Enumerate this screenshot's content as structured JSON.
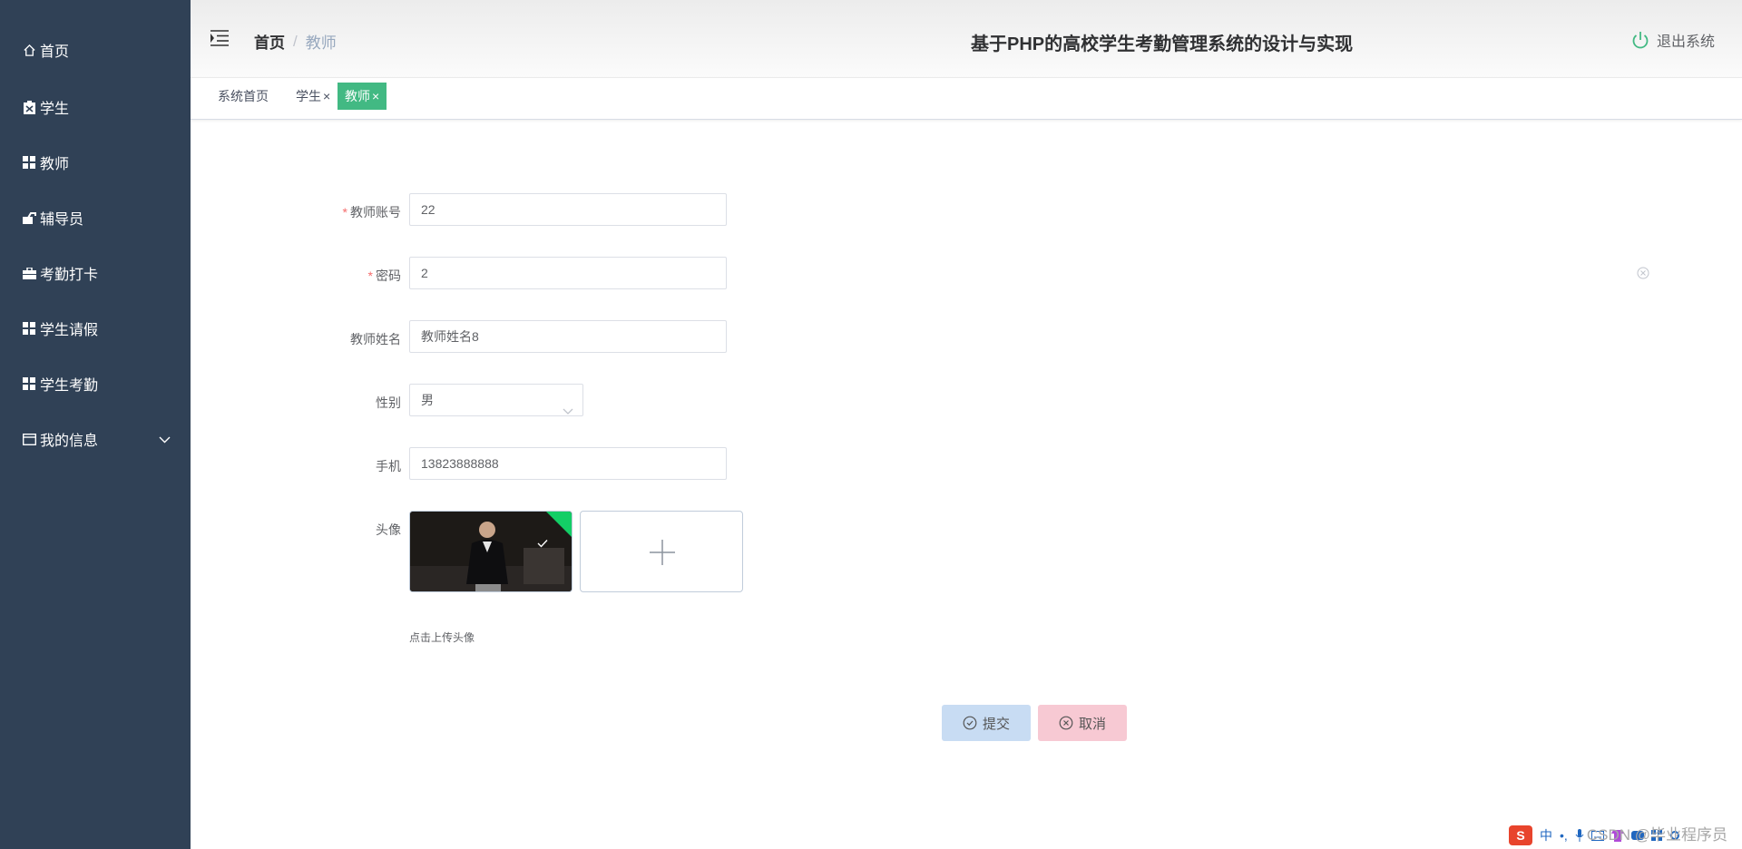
{
  "sidebar": {
    "items": [
      {
        "label": "首页",
        "icon": "home-icon"
      },
      {
        "label": "学生",
        "icon": "clipboard-icon"
      },
      {
        "label": "教师",
        "icon": "grid-icon"
      },
      {
        "label": "辅导员",
        "icon": "share-icon"
      },
      {
        "label": "考勤打卡",
        "icon": "briefcase-icon"
      },
      {
        "label": "学生请假",
        "icon": "grid-icon"
      },
      {
        "label": "学生考勤",
        "icon": "grid-icon"
      },
      {
        "label": "我的信息",
        "icon": "card-icon"
      }
    ]
  },
  "header": {
    "breadcrumb": [
      "首页",
      "教师"
    ],
    "breadcrumb_sep": "/",
    "title": "基于PHP的高校学生考勤管理系统的设计与实现",
    "logout": "退出系统"
  },
  "tags": [
    {
      "label": "系统首页",
      "closable": false,
      "active": false
    },
    {
      "label": "学生",
      "closable": true,
      "active": false
    },
    {
      "label": "教师",
      "closable": true,
      "active": true
    }
  ],
  "tag_close": "×",
  "form": {
    "account": {
      "label": "教师账号",
      "value": "22",
      "required": true
    },
    "password": {
      "label": "密码",
      "value": "2",
      "required": true
    },
    "name": {
      "label": "教师姓名",
      "value": "教师姓名8"
    },
    "gender": {
      "label": "性别",
      "value": "男"
    },
    "phone": {
      "label": "手机",
      "value": "13823888888"
    },
    "avatar": {
      "label": "头像",
      "hint": "点击上传头像"
    },
    "required_mark": "*"
  },
  "buttons": {
    "submit": "提交",
    "cancel": "取消"
  },
  "watermark": "CSDN @毕业程序员",
  "ime": {
    "logo": "S",
    "lang": "中"
  },
  "colors": {
    "sidebar": "#304156",
    "accent": "#42b983",
    "required": "#f56c6c",
    "success": "#13ce66"
  }
}
